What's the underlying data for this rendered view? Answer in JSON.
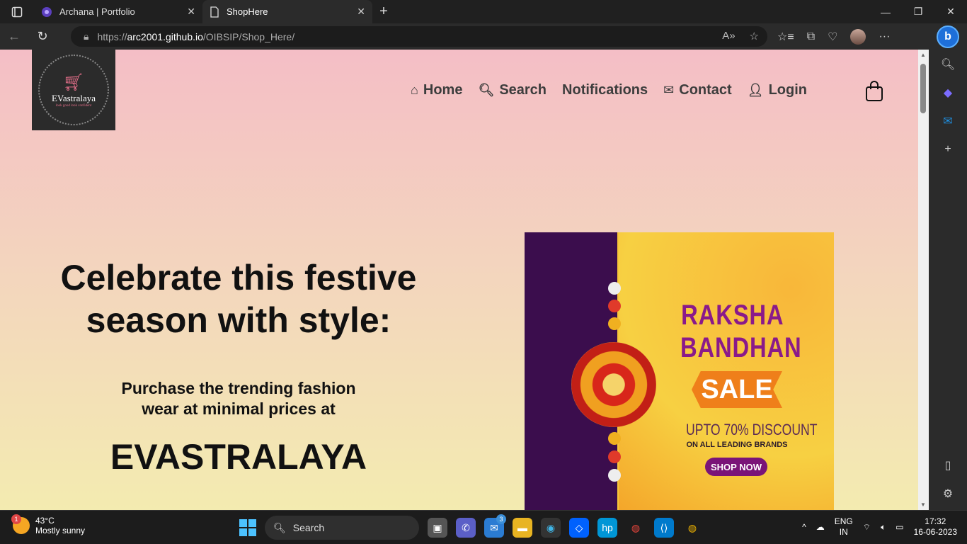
{
  "browser": {
    "tabs": [
      {
        "title": "Archana | Portfolio",
        "active": false
      },
      {
        "title": "ShopHere",
        "active": true
      }
    ],
    "url_prefix": "https://",
    "url_host": "arc2001.github.io",
    "url_path": "/OIBSIP/Shop_Here/"
  },
  "site": {
    "logo_name": "EVastralaya",
    "logo_tagline": "look good look confident",
    "nav": [
      {
        "label": "Home",
        "icon": "home-icon"
      },
      {
        "label": "Search",
        "icon": "search-icon"
      },
      {
        "label": "Notifications",
        "icon": ""
      },
      {
        "label": "Contact",
        "icon": "envelope-icon"
      },
      {
        "label": "Login",
        "icon": "user-icon"
      }
    ]
  },
  "hero": {
    "title_line1": "Celebrate this festive",
    "title_line2": "season with style:",
    "sub_line1": "Purchase the trending fashion",
    "sub_line2": "wear at minimal prices at",
    "brand": "EVASTRALAYA"
  },
  "banner": {
    "title_line1": "RAKSHA",
    "title_line2": "BANDHAN",
    "sale": "SALE",
    "discount": "UPTO 70% DISCOUNT",
    "brands": "ON ALL LEADING BRANDS",
    "cta": "SHOP NOW"
  },
  "taskbar": {
    "temperature": "43°C",
    "weather": "Mostly sunny",
    "weather_badge": "1",
    "search_placeholder": "Search",
    "mail_badge": "3",
    "lang_top": "ENG",
    "lang_bottom": "IN",
    "time": "17:32",
    "date": "16-06-2023"
  },
  "colors": {
    "accent_purple": "#8a1a8a",
    "sale_orange": "#ef7f1a",
    "page_top": "#f4bec6",
    "page_bottom": "#f3ebb0"
  }
}
